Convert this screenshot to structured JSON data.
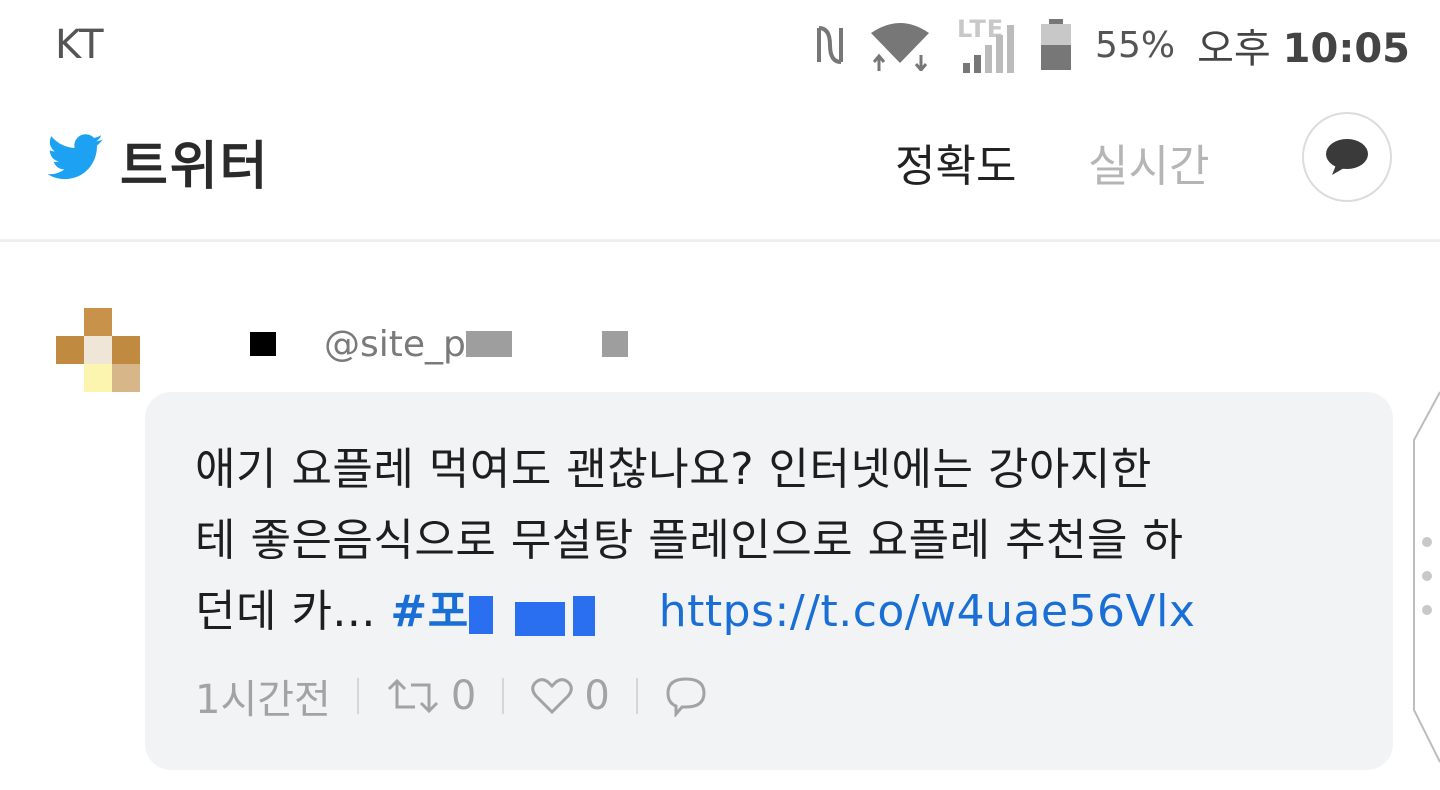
{
  "status_bar": {
    "carrier": "KT",
    "network": "LTE",
    "battery_percent": "55%",
    "ampm": "오후",
    "time": "10:05"
  },
  "header": {
    "app_title": "트위터",
    "tabs": [
      {
        "label": "정확도",
        "active": true
      },
      {
        "label": "실시간",
        "active": false
      }
    ]
  },
  "tweet": {
    "handle": "@site_p",
    "text_lines": [
      "애기 요플레 먹여도 괜찮나요? 인터넷에는 강아지한",
      "테 좋은음식으로 무설탕 플레인으로 요플레 추천을 하",
      "던데 카..."
    ],
    "hashtag": "#포",
    "link": "https://t.co/w4uae56Vlx",
    "time_ago": "1시간전",
    "retweet_count": "0",
    "like_count": "0"
  },
  "colors": {
    "twitter_blue": "#1da1f2",
    "link_blue": "#1a6fd6",
    "bubble_bg": "#f2f3f5"
  }
}
